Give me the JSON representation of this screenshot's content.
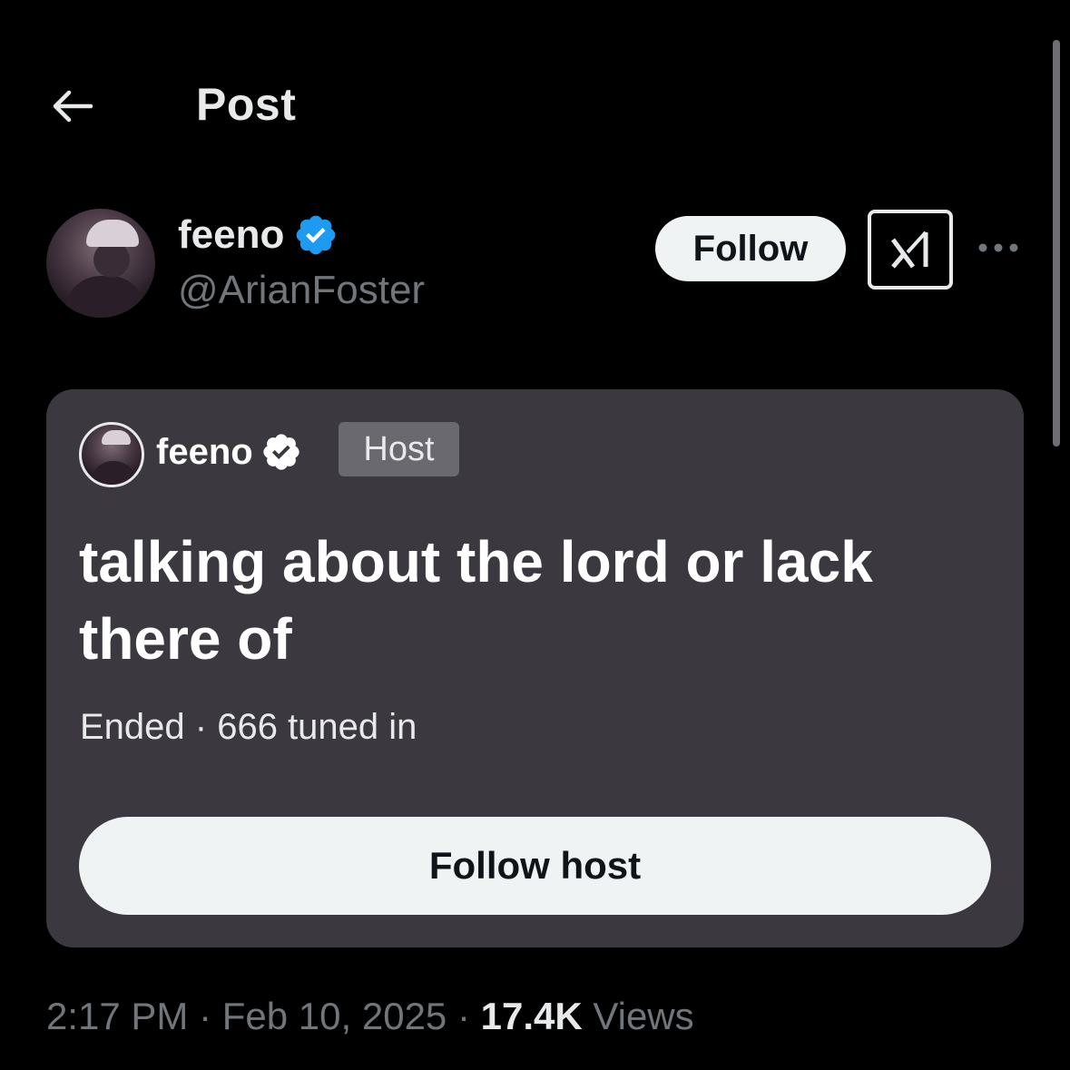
{
  "header": {
    "title": "Post",
    "back_icon": "arrow-left-icon"
  },
  "author": {
    "display_name": "feeno",
    "handle": "@ArianFoster",
    "verified_color": "#1d9bf0",
    "follow_label": "Follow",
    "grok_icon": "grok-icon",
    "more_icon": "more-horizontal-icon"
  },
  "space_card": {
    "host_name": "feeno",
    "host_badge": "Host",
    "title": "talking about the lord or lack there of",
    "status": "Ended · 666 tuned in",
    "follow_host_label": "Follow host",
    "background_color": "#3b393f"
  },
  "meta": {
    "time": "2:17 PM",
    "separator1": " · ",
    "date": "Feb 10, 2025",
    "separator2": " · ",
    "views_count": "17.4K",
    "views_label": " Views"
  }
}
